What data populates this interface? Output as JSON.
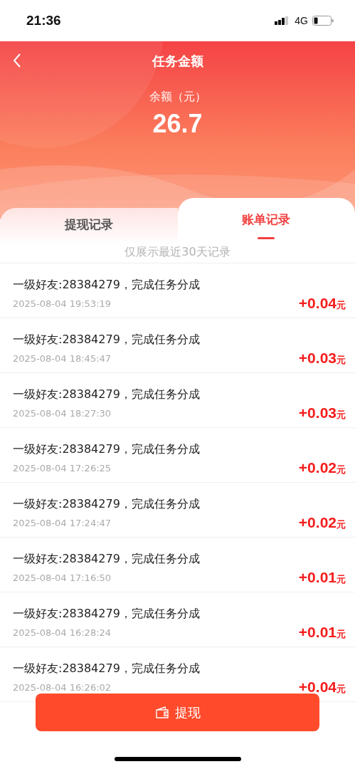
{
  "status_bar": {
    "time": "21:36",
    "network": "4G"
  },
  "header": {
    "title": "任务金额",
    "balance_label": "余额（元）",
    "balance": "26.7"
  },
  "tabs": [
    {
      "label": "提现记录",
      "selected": false
    },
    {
      "label": "账单记录",
      "selected": true
    }
  ],
  "notice": "仅展示最近30天记录",
  "records": [
    {
      "title": "一级好友:28384279，完成任务分成",
      "time": "2025-08-04 19:53:19",
      "amount": "+0.04",
      "unit": "元"
    },
    {
      "title": "一级好友:28384279，完成任务分成",
      "time": "2025-08-04 18:45:47",
      "amount": "+0.03",
      "unit": "元"
    },
    {
      "title": "一级好友:28384279，完成任务分成",
      "time": "2025-08-04 18:27:30",
      "amount": "+0.03",
      "unit": "元"
    },
    {
      "title": "一级好友:28384279，完成任务分成",
      "time": "2025-08-04 17:26:25",
      "amount": "+0.02",
      "unit": "元"
    },
    {
      "title": "一级好友:28384279，完成任务分成",
      "time": "2025-08-04 17:24:47",
      "amount": "+0.02",
      "unit": "元"
    },
    {
      "title": "一级好友:28384279，完成任务分成",
      "time": "2025-08-04 17:16:50",
      "amount": "+0.01",
      "unit": "元"
    },
    {
      "title": "一级好友:28384279，完成任务分成",
      "time": "2025-08-04 16:28:24",
      "amount": "+0.01",
      "unit": "元"
    },
    {
      "title": "一级好友:28384279，完成任务分成",
      "time": "2025-08-04 16:26:02",
      "amount": "+0.04",
      "unit": "元"
    }
  ],
  "withdraw_button": "提现"
}
